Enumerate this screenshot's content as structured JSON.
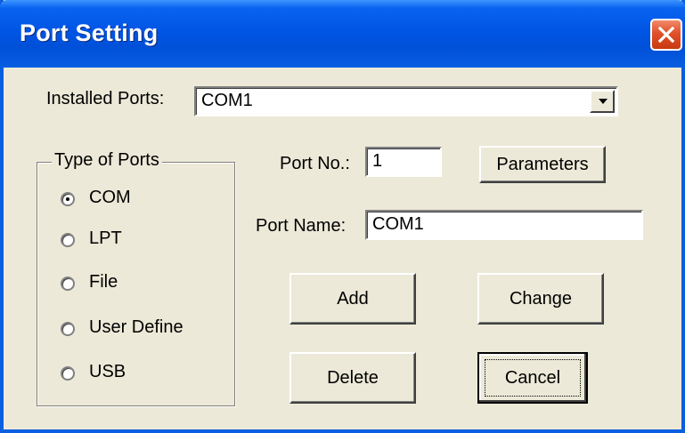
{
  "window": {
    "title": "Port Setting"
  },
  "installed_ports": {
    "label": "Installed Ports:",
    "value": "COM1"
  },
  "type_of_ports": {
    "legend": "Type of Ports",
    "options": [
      {
        "label": "COM",
        "selected": true
      },
      {
        "label": "LPT",
        "selected": false
      },
      {
        "label": "File",
        "selected": false
      },
      {
        "label": "User Define",
        "selected": false
      },
      {
        "label": "USB",
        "selected": false
      }
    ]
  },
  "port_no": {
    "label": "Port No.:",
    "value": "1"
  },
  "port_name": {
    "label": "Port Name:",
    "value": "COM1"
  },
  "buttons": {
    "parameters": "Parameters",
    "add": "Add",
    "change": "Change",
    "delete": "Delete",
    "cancel": "Cancel"
  },
  "icons": {
    "close": "close-icon",
    "dropdown": "chevron-down-icon"
  },
  "colors": {
    "titlebar": "#0055e5",
    "window_bg": "#ece9d8",
    "close_button": "#e0502a"
  }
}
